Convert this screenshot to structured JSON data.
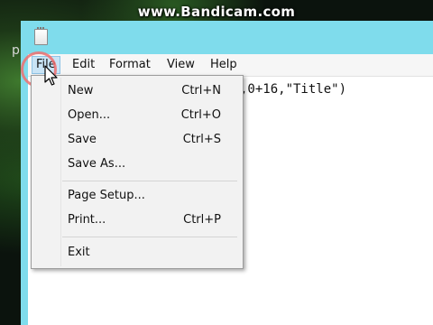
{
  "watermark": "www.Bandicam.com",
  "background_text": "p",
  "menubar": {
    "items": [
      {
        "label": "File"
      },
      {
        "label": "Edit"
      },
      {
        "label": "Format"
      },
      {
        "label": "View"
      },
      {
        "label": "Help"
      }
    ]
  },
  "editor": {
    "visible_text": ",0+16,\"Title\")"
  },
  "file_menu": {
    "items": [
      {
        "label": "New",
        "shortcut": "Ctrl+N"
      },
      {
        "label": "Open...",
        "shortcut": "Ctrl+O"
      },
      {
        "label": "Save",
        "shortcut": "Ctrl+S"
      },
      {
        "label": "Save As...",
        "shortcut": ""
      },
      {
        "label": "Page Setup...",
        "shortcut": ""
      },
      {
        "label": "Print...",
        "shortcut": "Ctrl+P"
      },
      {
        "label": "Exit",
        "shortcut": ""
      }
    ]
  },
  "colors": {
    "titlebar": "#7fdcec",
    "menu_highlight": "#c9e4f6",
    "click_ring": "#f06e6e"
  }
}
